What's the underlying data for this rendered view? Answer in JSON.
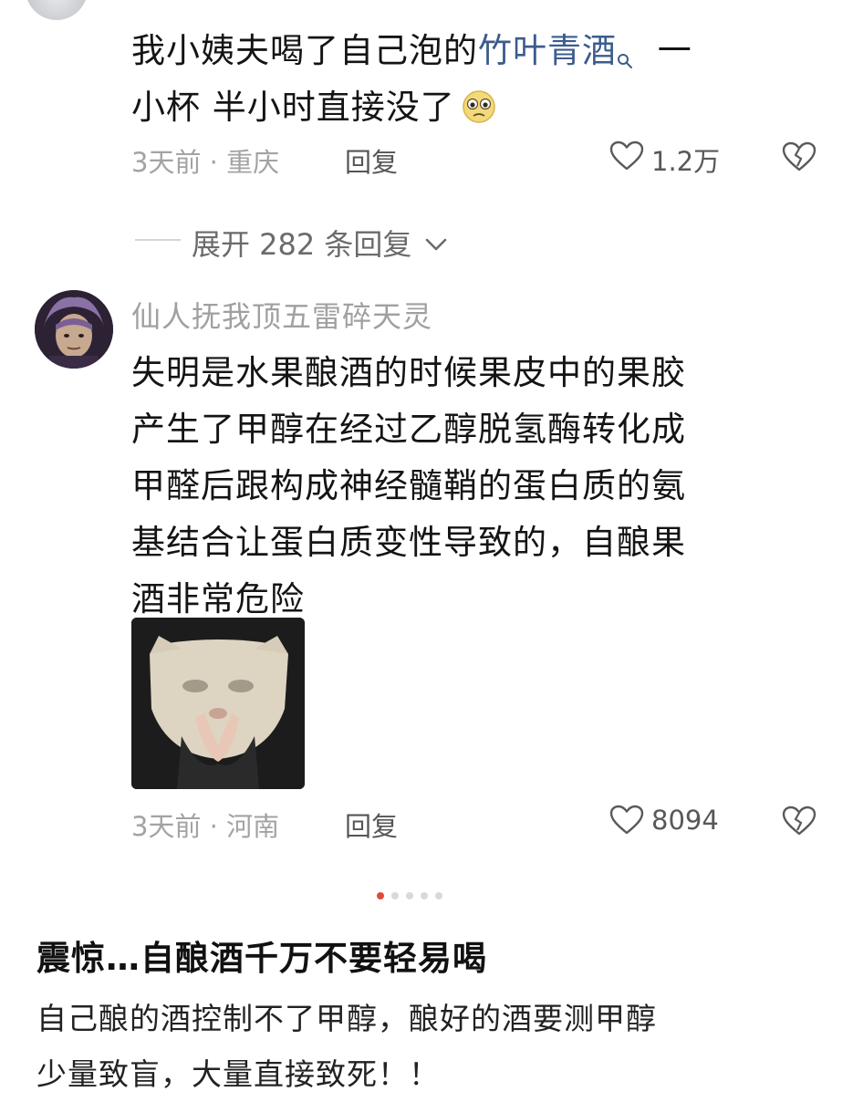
{
  "comment1": {
    "text_before": "我小姨夫喝了自己泡的",
    "highlight": "竹叶青酒",
    "text_after_line1": "一",
    "line2": "小杯  半小时直接没了",
    "time": "3天前",
    "separator": "·",
    "location": "重庆",
    "reply_label": "回复",
    "like_count": "1.2万"
  },
  "expand": {
    "label": "展开 282 条回复"
  },
  "comment2": {
    "username": "仙人抚我顶五雷碎天灵",
    "lines": [
      "失明是水果酿酒的时候果皮中的果胶",
      "产生了甲醇在经过乙醇脱氢酶转化成",
      "甲醛后跟构成神经髓鞘的蛋白质的氨",
      "基结合让蛋白质变性导致的，自酿果",
      "酒非常危险"
    ],
    "time": "3天前",
    "separator": "·",
    "location": "河南",
    "reply_label": "回复",
    "like_count": "8094"
  },
  "carousel": {
    "total": 5,
    "active": 0
  },
  "article": {
    "title": "震惊…自酿酒千万不要轻易喝",
    "line1": "自己酿的酒控制不了甲醇，酿好的酒要测甲醇",
    "line2": "少量致盲，大量直接致死！！"
  },
  "colors": {
    "accent_link": "#3c5c8d",
    "active_dot": "#e24a3b"
  },
  "icons": [
    "search-icon",
    "heart-icon",
    "broken-heart-icon",
    "chevron-down-icon",
    "anxious-face-emoji"
  ]
}
